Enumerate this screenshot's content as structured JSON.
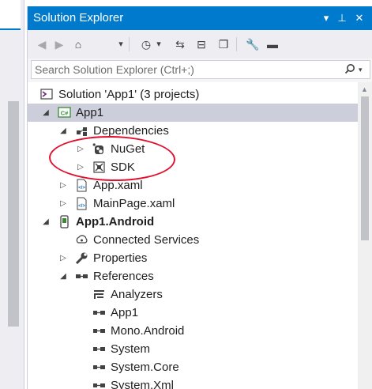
{
  "panel": {
    "title": "Solution Explorer",
    "title_buttons": [
      {
        "name": "window-position-dropdown-icon",
        "glyph": "▾"
      },
      {
        "name": "auto-hide-pin-icon",
        "glyph": "⊥"
      },
      {
        "name": "close-icon",
        "glyph": "✕"
      }
    ]
  },
  "toolbar": {
    "items": [
      {
        "name": "back-button",
        "glyph": "◀"
      },
      {
        "name": "forward-button",
        "glyph": "▶"
      },
      {
        "name": "home-button",
        "glyph": "⌂"
      },
      {
        "name": "switch-views-dropdown-icon",
        "glyph": "▾"
      },
      {
        "name": "pending-changes-filter-button",
        "glyph": "◷"
      },
      {
        "name": "pending-changes-dropdown-icon",
        "glyph": "▾"
      },
      {
        "name": "sync-with-active-document-button",
        "glyph": "⇆"
      },
      {
        "name": "collapse-all-button",
        "glyph": "⊟"
      },
      {
        "name": "show-all-files-button",
        "glyph": "❐"
      },
      {
        "name": "properties-button",
        "glyph": "🔧"
      },
      {
        "name": "preview-selected-items-button",
        "glyph": "▬"
      }
    ]
  },
  "search": {
    "placeholder": "Search Solution Explorer (Ctrl+;)"
  },
  "tree": [
    {
      "label": "Solution 'App1' (3 projects)",
      "icon": "solution-icon",
      "indent": 0,
      "expander": "",
      "selected": false,
      "bold": false
    },
    {
      "label": "App1",
      "icon": "csharp-project-icon",
      "indent": 1,
      "expander": "◢",
      "selected": true,
      "bold": false
    },
    {
      "label": "Dependencies",
      "icon": "dependencies-icon",
      "indent": 2,
      "expander": "◢",
      "selected": false,
      "bold": false
    },
    {
      "label": "NuGet",
      "icon": "nuget-icon",
      "indent": 3,
      "expander": "▷",
      "selected": false,
      "bold": false
    },
    {
      "label": "SDK",
      "icon": "sdk-icon",
      "indent": 3,
      "expander": "▷",
      "selected": false,
      "bold": false
    },
    {
      "label": "App.xaml",
      "icon": "xaml-file-icon",
      "indent": 2,
      "expander": "▷",
      "selected": false,
      "bold": false
    },
    {
      "label": "MainPage.xaml",
      "icon": "xaml-file-icon",
      "indent": 2,
      "expander": "▷",
      "selected": false,
      "bold": false
    },
    {
      "label": "App1.Android",
      "icon": "android-project-icon",
      "indent": 1,
      "expander": "◢",
      "selected": false,
      "bold": true
    },
    {
      "label": "Connected Services",
      "icon": "connected-services-icon",
      "indent": 2,
      "expander": "",
      "selected": false,
      "bold": false
    },
    {
      "label": "Properties",
      "icon": "wrench-icon",
      "indent": 2,
      "expander": "▷",
      "selected": false,
      "bold": false
    },
    {
      "label": "References",
      "icon": "references-icon",
      "indent": 2,
      "expander": "◢",
      "selected": false,
      "bold": false
    },
    {
      "label": "Analyzers",
      "icon": "analyzers-icon",
      "indent": 3,
      "expander": "",
      "selected": false,
      "bold": false
    },
    {
      "label": "App1",
      "icon": "reference-icon",
      "indent": 3,
      "expander": "",
      "selected": false,
      "bold": false
    },
    {
      "label": "Mono.Android",
      "icon": "reference-icon",
      "indent": 3,
      "expander": "",
      "selected": false,
      "bold": false
    },
    {
      "label": "System",
      "icon": "reference-icon",
      "indent": 3,
      "expander": "",
      "selected": false,
      "bold": false
    },
    {
      "label": "System.Core",
      "icon": "reference-icon",
      "indent": 3,
      "expander": "",
      "selected": false,
      "bold": false
    },
    {
      "label": "System.Xml",
      "icon": "reference-icon",
      "indent": 3,
      "expander": "",
      "selected": false,
      "bold": false
    }
  ],
  "colors": {
    "accent": "#007acc",
    "selection": "#cccedb",
    "annotation": "#e2102f"
  }
}
